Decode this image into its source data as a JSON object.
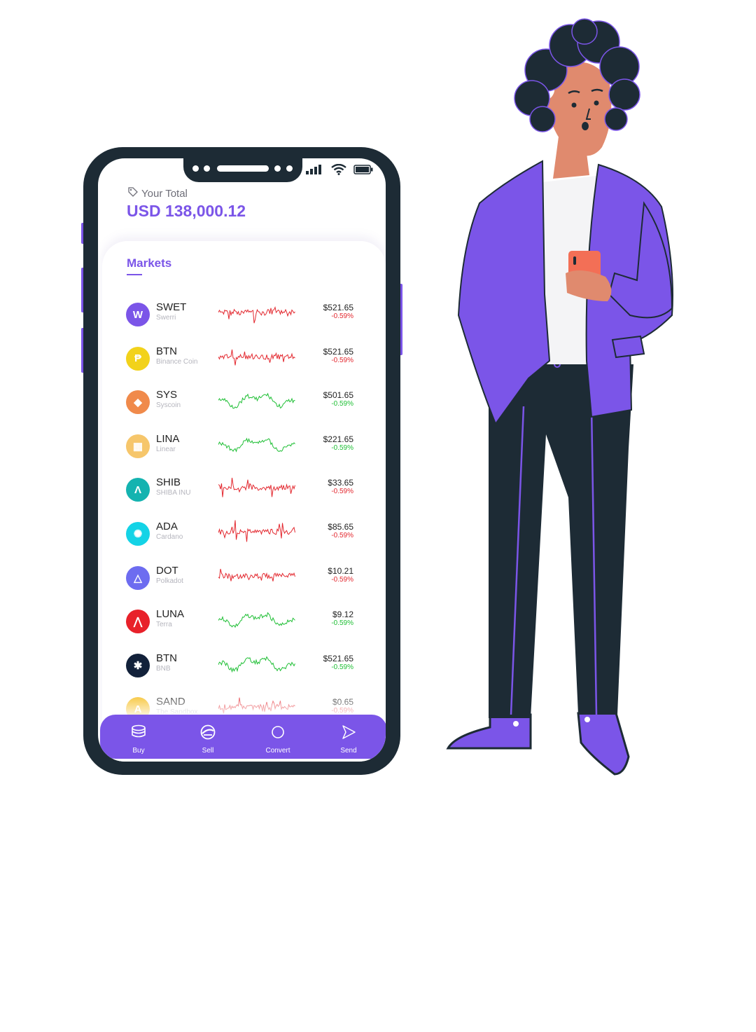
{
  "colors": {
    "accent": "#7b55e8",
    "phone_frame": "#1d2b35",
    "down": "#e3282f",
    "up": "#1fbf35"
  },
  "header": {
    "total_label": "Your Total",
    "total_value": "USD 138,000.12",
    "tag_icon": "tag-icon"
  },
  "status_bar": {
    "icons": [
      "signal-icon",
      "wifi-icon",
      "battery-icon"
    ]
  },
  "markets": {
    "tab_label": "Markets",
    "items": [
      {
        "symbol": "SWET",
        "name": "Swerri",
        "price": "$521.65",
        "change": "-0.59%",
        "trend": "down",
        "icon": "swerri-coin-icon",
        "icon_color": "#7b55e8",
        "glyph": "W"
      },
      {
        "symbol": "BTN",
        "name": "Binance Coin",
        "price": "$521.65",
        "change": "-0.59%",
        "trend": "down",
        "icon": "binance-coin-icon",
        "icon_color": "#f2d21b",
        "glyph": "₱"
      },
      {
        "symbol": "SYS",
        "name": "Syscoin",
        "price": "$501.65",
        "change": "-0.59%",
        "trend": "up",
        "icon": "syscoin-icon",
        "icon_color": "#f08a4b",
        "glyph": "◆"
      },
      {
        "symbol": "LINA",
        "name": "Linear",
        "price": "$221.65",
        "change": "-0.59%",
        "trend": "up",
        "icon": "linear-coin-icon",
        "icon_color": "#f6c66b",
        "glyph": "▦"
      },
      {
        "symbol": "SHIB",
        "name": "SHIBA INU",
        "price": "$33.65",
        "change": "-0.59%",
        "trend": "down",
        "icon": "shiba-coin-icon",
        "icon_color": "#14b3b0",
        "glyph": "Λ"
      },
      {
        "symbol": "ADA",
        "name": "Cardano",
        "price": "$85.65",
        "change": "-0.59%",
        "trend": "down",
        "icon": "cardano-coin-icon",
        "icon_color": "#14d3e6",
        "glyph": "✺"
      },
      {
        "symbol": "DOT",
        "name": "Polkadot",
        "price": "$10.21",
        "change": "-0.59%",
        "trend": "down",
        "icon": "polkadot-coin-icon",
        "icon_color": "#6d6cf0",
        "glyph": "△"
      },
      {
        "symbol": "LUNA",
        "name": "Terra",
        "price": "$9.12",
        "change": "-0.59%",
        "trend": "up",
        "icon": "terra-coin-icon",
        "icon_color": "#e8212a",
        "glyph": "⋀"
      },
      {
        "symbol": "BTN",
        "name": "BNB",
        "price": "$521.65",
        "change": "-0.59%",
        "trend": "up",
        "icon": "bnb-coin-icon",
        "icon_color": "#12213a",
        "glyph": "✱"
      },
      {
        "symbol": "SAND",
        "name": "The Sandbox",
        "price": "$0.65",
        "change": "-0.59%",
        "trend": "down",
        "icon": "sandbox-coin-icon",
        "icon_color": "#f5b90f",
        "glyph": "A"
      }
    ]
  },
  "nav": {
    "items": [
      {
        "label": "Buy",
        "icon": "coins-stack-icon"
      },
      {
        "label": "Sell",
        "icon": "sell-coin-icon"
      },
      {
        "label": "Convert",
        "icon": "convert-circle-icon"
      },
      {
        "label": "Send",
        "icon": "send-arrow-icon"
      }
    ]
  }
}
